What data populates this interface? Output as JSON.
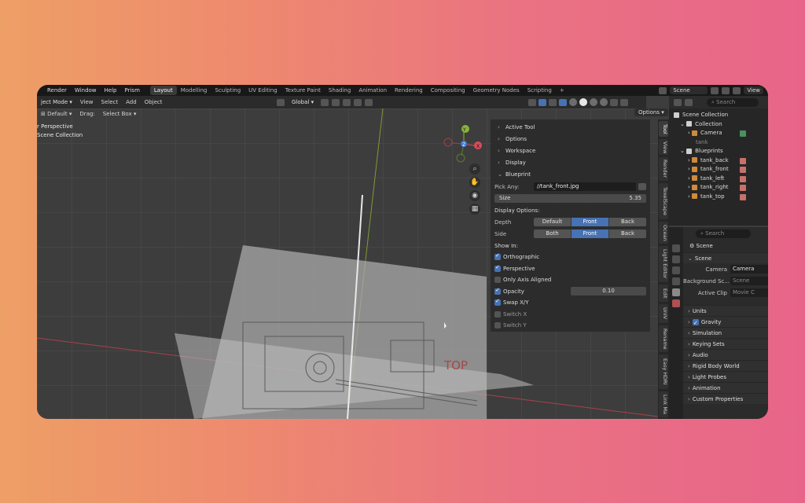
{
  "menu": [
    "Render",
    "Window",
    "Help",
    "Prism"
  ],
  "workspaces": [
    {
      "label": "Layout",
      "active": true
    },
    {
      "label": "Modelling"
    },
    {
      "label": "Sculpting"
    },
    {
      "label": "UV Editing"
    },
    {
      "label": "Texture Paint"
    },
    {
      "label": "Shading"
    },
    {
      "label": "Animation"
    },
    {
      "label": "Rendering"
    },
    {
      "label": "Compositing"
    },
    {
      "label": "Geometry Nodes"
    },
    {
      "label": "Scripting"
    }
  ],
  "add_workspace": "+",
  "scene_field": "Scene",
  "view_layer_field": "View",
  "header": {
    "mode": "ject Mode",
    "items": [
      "View",
      "Select",
      "Add",
      "Object"
    ],
    "transform": "Global"
  },
  "toolrow": {
    "orientation_label": "Default",
    "drag_label": "Drag:",
    "drag_value": "Select Box",
    "options_label": "Options"
  },
  "viewport": {
    "info_line1": "r Perspective",
    "info_line2": "Scene Collection",
    "blueprint_text": "TOP",
    "gizmo": {
      "x": "X",
      "y": "Y",
      "z": "Z"
    }
  },
  "npanel": {
    "sections": [
      "Active Tool",
      "Options",
      "Workspace",
      "Display",
      "Blueprint"
    ],
    "pick_any_label": "Pick Any:",
    "pick_any_value": "//tank_front.jpg",
    "size_label": "Size",
    "size_value": "5.35",
    "display_options_label": "Display Options:",
    "depth_label": "Depth",
    "depth_options": [
      "Default",
      "Front",
      "Back"
    ],
    "side_label": "Side",
    "side_options": [
      "Both",
      "Front",
      "Back"
    ],
    "show_in_label": "Show In:",
    "orthographic": "Orthographic",
    "perspective": "Perspective",
    "only_axis_aligned": "Only Axis Aligned",
    "opacity_label": "Opacity",
    "opacity_value": "0.10",
    "swap_xy": "Swap X/Y",
    "switch_x": "Switch X",
    "switch_y": "Switch Y"
  },
  "vertical_tabs": [
    "Tool",
    "View",
    "Render",
    "TexelScape",
    "Ocean",
    "Light Editor",
    "Edit",
    "UniV",
    "Rename",
    "Easy HDRI",
    "Link Ma"
  ],
  "outliner": {
    "search_placeholder": "Search",
    "scene_collection": "Scene Collection",
    "collection": "Collection",
    "camera": "Camera",
    "tank": "tank",
    "blueprints": "Blueprints",
    "items": [
      "tank_back",
      "tank_front",
      "tank_left",
      "tank_right",
      "tank_top"
    ]
  },
  "properties": {
    "search_placeholder": "Search",
    "title": "Scene",
    "scene_section": "Scene",
    "camera_label": "Camera",
    "camera_value": "Camera",
    "background_label": "Background Sc...",
    "background_value": "Scene",
    "active_clip_label": "Active Clip",
    "active_clip_value": "Movie C",
    "sections": [
      "Units",
      "Gravity",
      "Simulation",
      "Keying Sets",
      "Audio",
      "Rigid Body World",
      "Light Probes",
      "Animation",
      "Custom Properties"
    ]
  },
  "colors": {
    "accent": "#4772b3",
    "x_axis": "#d94c5a",
    "y_axis": "#8ab33c",
    "z_axis": "#3c7ad9"
  }
}
